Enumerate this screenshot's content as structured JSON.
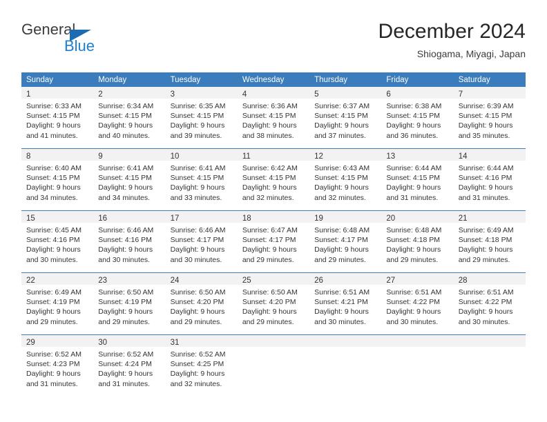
{
  "brand": {
    "name_part1": "General",
    "name_part2": "Blue",
    "triangle_color": "#1b6cb5",
    "blue_color": "#1b7fd4"
  },
  "header": {
    "title": "December 2024",
    "subtitle": "Shiogama, Miyagi, Japan"
  },
  "theme": {
    "header_blue": "#3b7cbd",
    "daynum_band": "#f2f2f2",
    "text": "#333333"
  },
  "weekdays": [
    "Sunday",
    "Monday",
    "Tuesday",
    "Wednesday",
    "Thursday",
    "Friday",
    "Saturday"
  ],
  "weeks": [
    [
      {
        "day": "1",
        "lines": [
          "Sunrise: 6:33 AM",
          "Sunset: 4:15 PM",
          "Daylight: 9 hours",
          "and 41 minutes."
        ]
      },
      {
        "day": "2",
        "lines": [
          "Sunrise: 6:34 AM",
          "Sunset: 4:15 PM",
          "Daylight: 9 hours",
          "and 40 minutes."
        ]
      },
      {
        "day": "3",
        "lines": [
          "Sunrise: 6:35 AM",
          "Sunset: 4:15 PM",
          "Daylight: 9 hours",
          "and 39 minutes."
        ]
      },
      {
        "day": "4",
        "lines": [
          "Sunrise: 6:36 AM",
          "Sunset: 4:15 PM",
          "Daylight: 9 hours",
          "and 38 minutes."
        ]
      },
      {
        "day": "5",
        "lines": [
          "Sunrise: 6:37 AM",
          "Sunset: 4:15 PM",
          "Daylight: 9 hours",
          "and 37 minutes."
        ]
      },
      {
        "day": "6",
        "lines": [
          "Sunrise: 6:38 AM",
          "Sunset: 4:15 PM",
          "Daylight: 9 hours",
          "and 36 minutes."
        ]
      },
      {
        "day": "7",
        "lines": [
          "Sunrise: 6:39 AM",
          "Sunset: 4:15 PM",
          "Daylight: 9 hours",
          "and 35 minutes."
        ]
      }
    ],
    [
      {
        "day": "8",
        "lines": [
          "Sunrise: 6:40 AM",
          "Sunset: 4:15 PM",
          "Daylight: 9 hours",
          "and 34 minutes."
        ]
      },
      {
        "day": "9",
        "lines": [
          "Sunrise: 6:41 AM",
          "Sunset: 4:15 PM",
          "Daylight: 9 hours",
          "and 34 minutes."
        ]
      },
      {
        "day": "10",
        "lines": [
          "Sunrise: 6:41 AM",
          "Sunset: 4:15 PM",
          "Daylight: 9 hours",
          "and 33 minutes."
        ]
      },
      {
        "day": "11",
        "lines": [
          "Sunrise: 6:42 AM",
          "Sunset: 4:15 PM",
          "Daylight: 9 hours",
          "and 32 minutes."
        ]
      },
      {
        "day": "12",
        "lines": [
          "Sunrise: 6:43 AM",
          "Sunset: 4:15 PM",
          "Daylight: 9 hours",
          "and 32 minutes."
        ]
      },
      {
        "day": "13",
        "lines": [
          "Sunrise: 6:44 AM",
          "Sunset: 4:15 PM",
          "Daylight: 9 hours",
          "and 31 minutes."
        ]
      },
      {
        "day": "14",
        "lines": [
          "Sunrise: 6:44 AM",
          "Sunset: 4:16 PM",
          "Daylight: 9 hours",
          "and 31 minutes."
        ]
      }
    ],
    [
      {
        "day": "15",
        "lines": [
          "Sunrise: 6:45 AM",
          "Sunset: 4:16 PM",
          "Daylight: 9 hours",
          "and 30 minutes."
        ]
      },
      {
        "day": "16",
        "lines": [
          "Sunrise: 6:46 AM",
          "Sunset: 4:16 PM",
          "Daylight: 9 hours",
          "and 30 minutes."
        ]
      },
      {
        "day": "17",
        "lines": [
          "Sunrise: 6:46 AM",
          "Sunset: 4:17 PM",
          "Daylight: 9 hours",
          "and 30 minutes."
        ]
      },
      {
        "day": "18",
        "lines": [
          "Sunrise: 6:47 AM",
          "Sunset: 4:17 PM",
          "Daylight: 9 hours",
          "and 29 minutes."
        ]
      },
      {
        "day": "19",
        "lines": [
          "Sunrise: 6:48 AM",
          "Sunset: 4:17 PM",
          "Daylight: 9 hours",
          "and 29 minutes."
        ]
      },
      {
        "day": "20",
        "lines": [
          "Sunrise: 6:48 AM",
          "Sunset: 4:18 PM",
          "Daylight: 9 hours",
          "and 29 minutes."
        ]
      },
      {
        "day": "21",
        "lines": [
          "Sunrise: 6:49 AM",
          "Sunset: 4:18 PM",
          "Daylight: 9 hours",
          "and 29 minutes."
        ]
      }
    ],
    [
      {
        "day": "22",
        "lines": [
          "Sunrise: 6:49 AM",
          "Sunset: 4:19 PM",
          "Daylight: 9 hours",
          "and 29 minutes."
        ]
      },
      {
        "day": "23",
        "lines": [
          "Sunrise: 6:50 AM",
          "Sunset: 4:19 PM",
          "Daylight: 9 hours",
          "and 29 minutes."
        ]
      },
      {
        "day": "24",
        "lines": [
          "Sunrise: 6:50 AM",
          "Sunset: 4:20 PM",
          "Daylight: 9 hours",
          "and 29 minutes."
        ]
      },
      {
        "day": "25",
        "lines": [
          "Sunrise: 6:50 AM",
          "Sunset: 4:20 PM",
          "Daylight: 9 hours",
          "and 29 minutes."
        ]
      },
      {
        "day": "26",
        "lines": [
          "Sunrise: 6:51 AM",
          "Sunset: 4:21 PM",
          "Daylight: 9 hours",
          "and 30 minutes."
        ]
      },
      {
        "day": "27",
        "lines": [
          "Sunrise: 6:51 AM",
          "Sunset: 4:22 PM",
          "Daylight: 9 hours",
          "and 30 minutes."
        ]
      },
      {
        "day": "28",
        "lines": [
          "Sunrise: 6:51 AM",
          "Sunset: 4:22 PM",
          "Daylight: 9 hours",
          "and 30 minutes."
        ]
      }
    ],
    [
      {
        "day": "29",
        "lines": [
          "Sunrise: 6:52 AM",
          "Sunset: 4:23 PM",
          "Daylight: 9 hours",
          "and 31 minutes."
        ]
      },
      {
        "day": "30",
        "lines": [
          "Sunrise: 6:52 AM",
          "Sunset: 4:24 PM",
          "Daylight: 9 hours",
          "and 31 minutes."
        ]
      },
      {
        "day": "31",
        "lines": [
          "Sunrise: 6:52 AM",
          "Sunset: 4:25 PM",
          "Daylight: 9 hours",
          "and 32 minutes."
        ]
      },
      {
        "day": "",
        "lines": []
      },
      {
        "day": "",
        "lines": []
      },
      {
        "day": "",
        "lines": []
      },
      {
        "day": "",
        "lines": []
      }
    ]
  ]
}
